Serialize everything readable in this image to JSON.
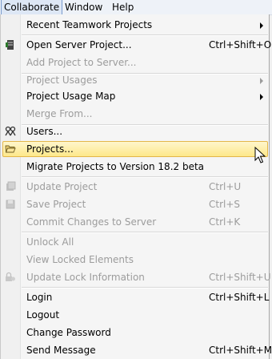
{
  "menubar": {
    "items": [
      {
        "label": "Collaborate"
      },
      {
        "label": "Window"
      },
      {
        "label": "Help"
      }
    ]
  },
  "menu": {
    "items": [
      {
        "label": "Recent Teamwork Projects",
        "shortcut": "",
        "submenu": true,
        "enabled": true,
        "icon": ""
      },
      {
        "label": "Open Server Project...",
        "shortcut": "Ctrl+Shift+O",
        "enabled": true,
        "icon": "server-project-icon"
      },
      {
        "label": "Add Project to Server...",
        "shortcut": "",
        "enabled": false
      },
      {
        "label": "Project Usages",
        "shortcut": "",
        "submenu": true,
        "enabled": false
      },
      {
        "label": "Project Usage Map",
        "shortcut": "",
        "submenu": true,
        "enabled": true
      },
      {
        "label": "Merge From...",
        "shortcut": "",
        "enabled": false
      },
      {
        "label": "Users...",
        "shortcut": "",
        "enabled": true,
        "icon": "users-icon"
      },
      {
        "label": "Projects...",
        "shortcut": "",
        "enabled": true,
        "highlighted": true,
        "icon": "folder-open-icon"
      },
      {
        "label": "Migrate Projects to Version 18.2 beta",
        "shortcut": "",
        "enabled": true
      },
      {
        "label": "Update Project",
        "shortcut": "Ctrl+U",
        "enabled": false,
        "icon": "update-project-icon"
      },
      {
        "label": "Save Project",
        "shortcut": "Ctrl+S",
        "enabled": false,
        "icon": "save-project-icon"
      },
      {
        "label": "Commit Changes to Server",
        "shortcut": "Ctrl+K",
        "enabled": false
      },
      {
        "label": "Unlock All",
        "shortcut": "",
        "enabled": false
      },
      {
        "label": "View Locked Elements",
        "shortcut": "",
        "enabled": false
      },
      {
        "label": "Update Lock Information",
        "shortcut": "Ctrl+Shift+U",
        "enabled": false,
        "icon": "lock-info-icon"
      },
      {
        "label": "Login",
        "shortcut": "Ctrl+Shift+L",
        "enabled": true
      },
      {
        "label": "Logout",
        "shortcut": "",
        "enabled": true
      },
      {
        "label": "Change Password",
        "shortcut": "",
        "enabled": true
      },
      {
        "label": "Send Message",
        "shortcut": "Ctrl+Shift+M",
        "enabled": true
      }
    ]
  },
  "colors": {
    "highlight_border": "#e3b64a",
    "highlight_fill": "#fde88a",
    "disabled_text": "#9c9c9c"
  }
}
